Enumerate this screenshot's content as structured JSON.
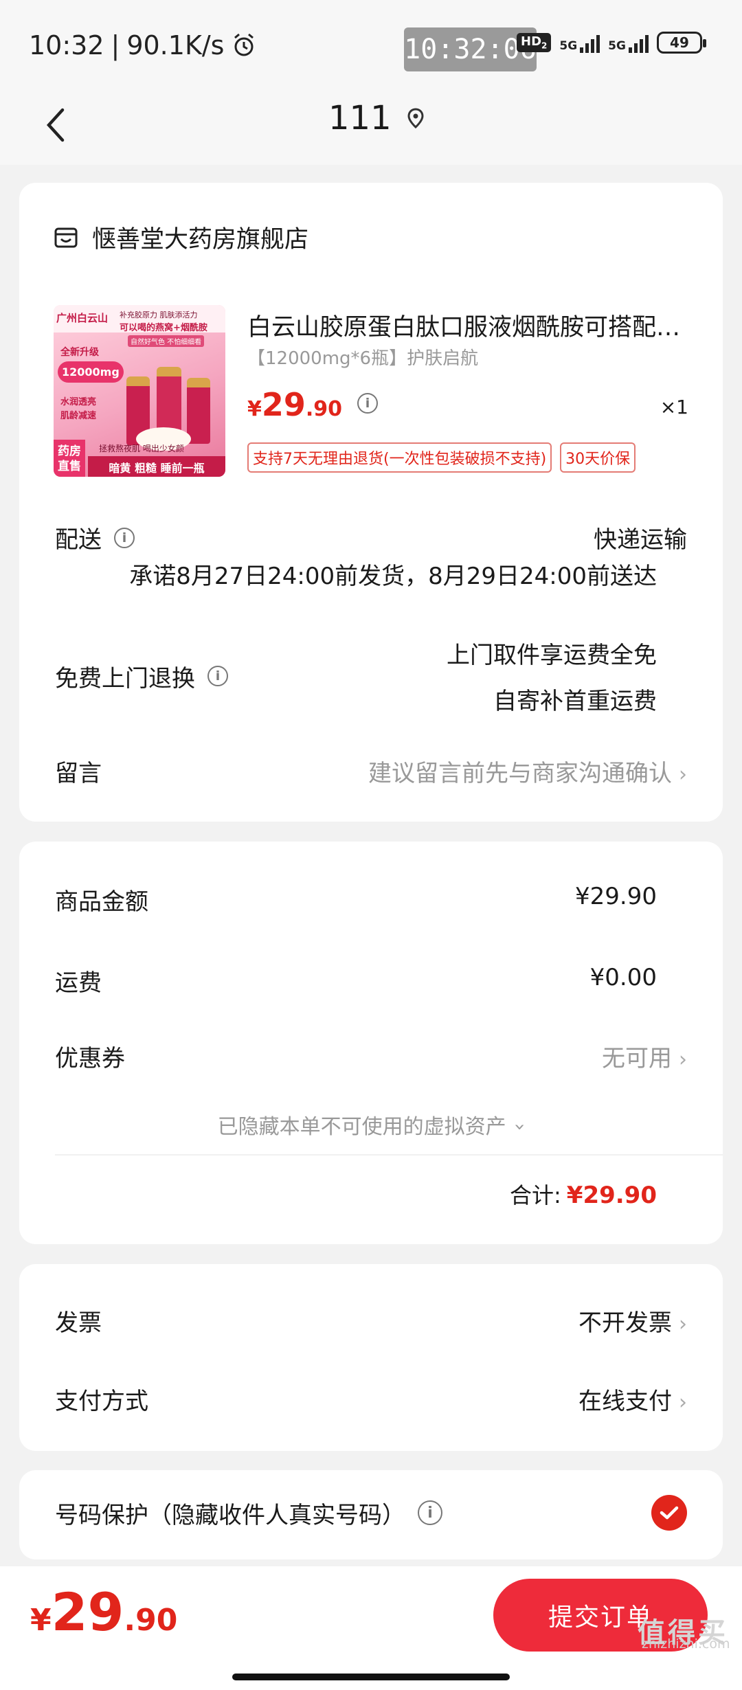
{
  "status_bar": {
    "time": "10:32",
    "speed": "90.1K/s",
    "clock_overlay": "10:32:06",
    "hd": "HD",
    "hd_sub": "2",
    "net1": "5G",
    "net2": "5G",
    "battery": "49"
  },
  "nav": {
    "title": "111"
  },
  "order": {
    "store_name": "惬善堂大药房旗舰店",
    "product": {
      "title": "白云山胶原蛋白肽口服液烟酰胺可搭配燕窝",
      "spec": "【12000mg*6瓶】护肤启航",
      "price_symbol": "¥",
      "price_int": "29",
      "price_dec": ".90",
      "quantity": "×1",
      "tags": [
        "支持7天无理由退货(一次性包装破损不支持)",
        "30天价保"
      ],
      "image_text": {
        "brand": "广州白云山",
        "slogan1": "补充胶原力 肌肤添活力",
        "slogan2": "可以喝的燕窝+烟酰胺",
        "slogan3": "自然好气色 不怕细细看",
        "badge1": "全新升级",
        "badge2": "12000mg",
        "badge3": "水润透亮",
        "badge4": "肌龄减速",
        "badge5": "药房",
        "badge6": "直售",
        "line1": "拯救熬夜肌 喝出少女颜",
        "line2": "暗黄 粗糙 睡前一瓶"
      }
    },
    "delivery": {
      "label": "配送",
      "method": "快递运输",
      "promise": "承诺8月27日24:00前发货，8月29日24:00前送达"
    },
    "return": {
      "label": "免费上门退换",
      "line1": "上门取件享运费全免",
      "line2": "自寄补首重运费"
    },
    "message": {
      "label": "留言",
      "placeholder": "建议留言前先与商家沟通确认"
    }
  },
  "summary": {
    "goods_label": "商品金额",
    "goods_value": "¥29.90",
    "shipping_label": "运费",
    "shipping_value": "¥0.00",
    "coupon_label": "优惠券",
    "coupon_value": "无可用",
    "hidden_assets": "已隐藏本单不可使用的虚拟资产",
    "total_label": "合计:",
    "total_value": "¥29.90"
  },
  "invoice": {
    "label": "发票",
    "value": "不开发票"
  },
  "payment": {
    "label": "支付方式",
    "value": "在线支付"
  },
  "privacy": {
    "label": "号码保护（隐藏收件人真实号码）",
    "checked": true
  },
  "bottom": {
    "price_symbol": "¥",
    "price_int": "29",
    "price_dec": ".90",
    "submit": "提交订单",
    "watermark": "值得买",
    "watermark_url": "zhizhizhi.com"
  },
  "colors": {
    "accent": "#e1251b",
    "button": "#ee2b3a",
    "background": "#f2f2f2"
  }
}
